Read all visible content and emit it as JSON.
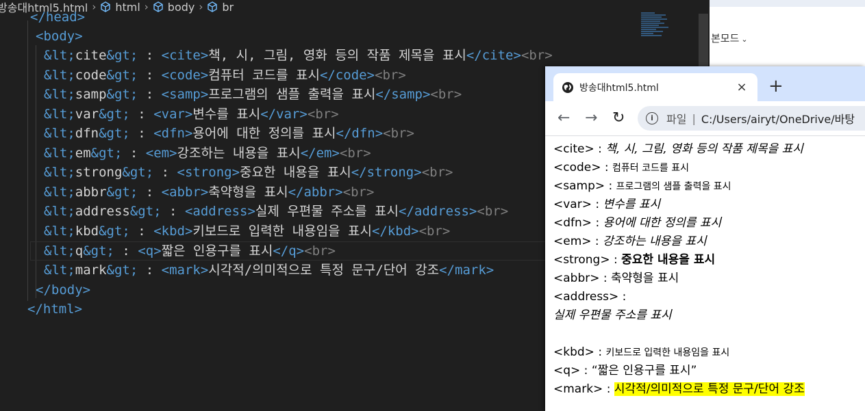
{
  "editor": {
    "breadcrumb": {
      "file": "방송대html5.html",
      "items": [
        "html",
        "body",
        "br"
      ]
    },
    "lines": [
      [
        [
          "tag",
          "</head>"
        ]
      ],
      [
        [
          "tag",
          "<body>"
        ]
      ],
      [
        [
          "ent",
          "&lt;"
        ],
        [
          "txt",
          "cite"
        ],
        [
          "ent",
          "&gt;"
        ],
        [
          "txt",
          " : "
        ],
        [
          "tag",
          "<cite>"
        ],
        [
          "txt",
          "책, 시, 그림, 영화 등의 작품 제목을 표시"
        ],
        [
          "tag",
          "</cite>"
        ],
        [
          "br",
          "<br>"
        ]
      ],
      [
        [
          "ent",
          "&lt;"
        ],
        [
          "txt",
          "code"
        ],
        [
          "ent",
          "&gt;"
        ],
        [
          "txt",
          " : "
        ],
        [
          "tag",
          "<code>"
        ],
        [
          "txt",
          "컴퓨터 코드를 표시"
        ],
        [
          "tag",
          "</code>"
        ],
        [
          "br",
          "<br>"
        ]
      ],
      [
        [
          "ent",
          "&lt;"
        ],
        [
          "txt",
          "samp"
        ],
        [
          "ent",
          "&gt;"
        ],
        [
          "txt",
          " : "
        ],
        [
          "tag",
          "<samp>"
        ],
        [
          "txt",
          "프로그램의 샘플 출력을 표시"
        ],
        [
          "tag",
          "</samp>"
        ],
        [
          "br",
          "<br>"
        ]
      ],
      [
        [
          "ent",
          "&lt;"
        ],
        [
          "txt",
          "var"
        ],
        [
          "ent",
          "&gt;"
        ],
        [
          "txt",
          " : "
        ],
        [
          "tag",
          "<var>"
        ],
        [
          "txt",
          "변수를 표시"
        ],
        [
          "tag",
          "</var>"
        ],
        [
          "br",
          "<br>"
        ]
      ],
      [
        [
          "ent",
          "&lt;"
        ],
        [
          "txt",
          "dfn"
        ],
        [
          "ent",
          "&gt;"
        ],
        [
          "txt",
          " : "
        ],
        [
          "tag",
          "<dfn>"
        ],
        [
          "txt",
          "용어에 대한 정의를 표시"
        ],
        [
          "tag",
          "</dfn>"
        ],
        [
          "br",
          "<br>"
        ]
      ],
      [
        [
          "ent",
          "&lt;"
        ],
        [
          "txt",
          "em"
        ],
        [
          "ent",
          "&gt;"
        ],
        [
          "txt",
          " : "
        ],
        [
          "tag",
          "<em>"
        ],
        [
          "txt",
          "강조하는 내용을 표시"
        ],
        [
          "tag",
          "</em>"
        ],
        [
          "br",
          "<br>"
        ]
      ],
      [
        [
          "ent",
          "&lt;"
        ],
        [
          "txt",
          "strong"
        ],
        [
          "ent",
          "&gt;"
        ],
        [
          "txt",
          " : "
        ],
        [
          "tag",
          "<strong>"
        ],
        [
          "txt",
          "중요한 내용을 표시"
        ],
        [
          "tag",
          "</strong>"
        ],
        [
          "br",
          "<br>"
        ]
      ],
      [
        [
          "ent",
          "&lt;"
        ],
        [
          "txt",
          "abbr"
        ],
        [
          "ent",
          "&gt;"
        ],
        [
          "txt",
          " : "
        ],
        [
          "tag",
          "<abbr>"
        ],
        [
          "txt",
          "축약형을 표시"
        ],
        [
          "tag",
          "</abbr>"
        ],
        [
          "br",
          "<br>"
        ]
      ],
      [
        [
          "ent",
          "&lt;"
        ],
        [
          "txt",
          "address"
        ],
        [
          "ent",
          "&gt;"
        ],
        [
          "txt",
          " : "
        ],
        [
          "tag",
          "<address>"
        ],
        [
          "txt",
          "실제 우편물 주소를 표시"
        ],
        [
          "tag",
          "</address>"
        ],
        [
          "br",
          "<br>"
        ]
      ],
      [
        [
          "ent",
          "&lt;"
        ],
        [
          "txt",
          "kbd"
        ],
        [
          "ent",
          "&gt;"
        ],
        [
          "txt",
          " : "
        ],
        [
          "tag",
          "<kbd>"
        ],
        [
          "txt",
          "키보드로 입력한 내용임을 표시"
        ],
        [
          "tag",
          "</kbd>"
        ],
        [
          "br",
          "<br>"
        ]
      ],
      [
        [
          "ent",
          "&lt;"
        ],
        [
          "txt",
          "q"
        ],
        [
          "ent",
          "&gt;"
        ],
        [
          "txt",
          " : "
        ],
        [
          "tag",
          "<q>"
        ],
        [
          "txt",
          "짧은 인용구를 표시"
        ],
        [
          "tag",
          "</q>"
        ],
        [
          "br",
          "<br>"
        ]
      ],
      [
        [
          "ent",
          "&lt;"
        ],
        [
          "txt",
          "mark"
        ],
        [
          "ent",
          "&gt;"
        ],
        [
          "txt",
          " : "
        ],
        [
          "tag",
          "<mark>"
        ],
        [
          "txt",
          "시각적/의미적으로 특정 문구/단어 강조"
        ],
        [
          "tag",
          "</mark>"
        ]
      ],
      [
        [
          "tag",
          "</body>"
        ]
      ],
      [
        [
          "tag",
          "</html>"
        ]
      ]
    ]
  },
  "background_window": {
    "reader_mode": "본모드"
  },
  "browser": {
    "tab_title": "방송대html5.html",
    "tab_close": "×",
    "new_tab": "+",
    "back": "←",
    "forward": "→",
    "reload": "↻",
    "address_label": "파일",
    "address_sep": "|",
    "url": "C:/Users/airyt/OneDrive/바탕"
  },
  "page": {
    "rows": [
      {
        "label": "<cite> : ",
        "value": "책, 시, 그림, 영화 등의 작품 제목을 표시",
        "style": "ital"
      },
      {
        "label": "<code> : ",
        "value": "컴퓨터 코드를 표시",
        "style": "small"
      },
      {
        "label": "<samp> : ",
        "value": "프로그램의 샘플 출력을 표시",
        "style": "small"
      },
      {
        "label": "<var> : ",
        "value": "변수를 표시",
        "style": "ital"
      },
      {
        "label": "<dfn> : ",
        "value": "용어에 대한 정의를 표시",
        "style": "ital"
      },
      {
        "label": "<em> : ",
        "value": "강조하는 내용을 표시",
        "style": "ital"
      },
      {
        "label": "<strong> : ",
        "value": "중요한 내용을 표시",
        "style": "bold"
      },
      {
        "label": "<abbr> : ",
        "value": "축약형을 표시",
        "style": ""
      },
      {
        "label": "<address> : ",
        "value": "",
        "style": ""
      },
      {
        "label": "",
        "value": "실제 우편물 주소를 표시",
        "style": "ital"
      },
      {
        "label": "<kbd> : ",
        "value": "키보드로 입력한 내용임을 표시",
        "style": "small"
      },
      {
        "label": "<q> : ",
        "value": "“짧은 인용구를 표시”",
        "style": ""
      },
      {
        "label": "<mark> : ",
        "value": "시각적/의미적으로 특정 문구/단어 강조",
        "style": "mark"
      }
    ]
  }
}
